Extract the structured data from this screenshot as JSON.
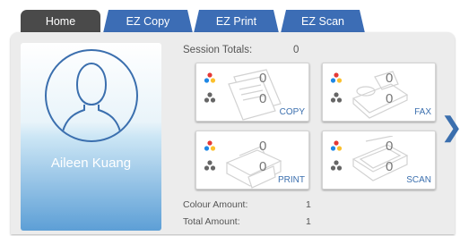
{
  "tabs": [
    "Home",
    "EZ Copy",
    "EZ Print",
    "EZ Scan"
  ],
  "user": {
    "name": "Aileen Kuang"
  },
  "session": {
    "label": "Session Totals:",
    "value": "0"
  },
  "cards": [
    {
      "label": "COPY",
      "colour": "0",
      "mono": "0"
    },
    {
      "label": "FAX",
      "colour": "0",
      "mono": "0"
    },
    {
      "label": "PRINT",
      "colour": "0",
      "mono": "0"
    },
    {
      "label": "SCAN",
      "colour": "0",
      "mono": "0"
    }
  ],
  "amounts": {
    "colour_label": "Colour Amount:",
    "colour_value": "1",
    "total_label": "Total Amount:",
    "total_value": "1"
  },
  "colors": {
    "tab_active": "#4a4a4a",
    "tab": "#3c6db5",
    "accent": "#3b6fae"
  },
  "icons": {
    "colour": "colour-dots-icon",
    "mono": "mono-dots-icon",
    "next": "chevron-right-icon"
  }
}
